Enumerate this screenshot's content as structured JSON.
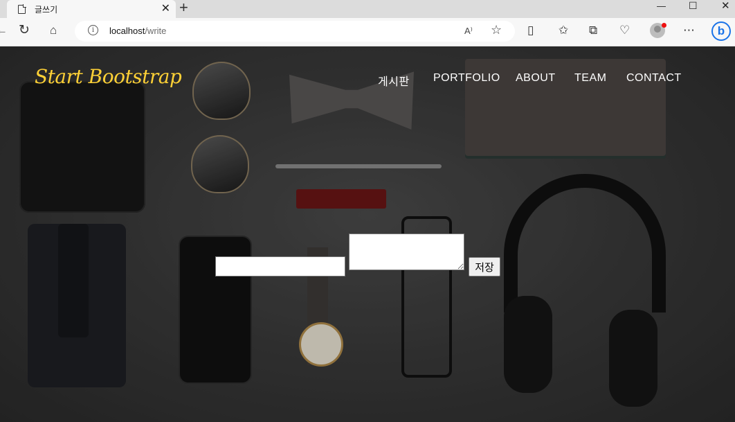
{
  "browser": {
    "tab_title": "글쓰기",
    "tab_close": "✕",
    "new_tab": "+",
    "window": {
      "minimize": "—",
      "maximize": "☐",
      "close": "✕"
    },
    "address": {
      "host": "localhost",
      "path": "/write"
    },
    "read_aloud": "A⁾",
    "icons": [
      "back-icon",
      "refresh-icon",
      "home-icon",
      "info-icon",
      "read-aloud-icon",
      "favorite-star-icon",
      "split-screen-icon",
      "favorites-icon",
      "collections-icon",
      "browser-essentials-icon",
      "profile-avatar-icon",
      "more-menu-icon",
      "bing-chat-icon"
    ]
  },
  "site": {
    "brand": "Start Bootstrap",
    "brand_color": "#fed136",
    "nav": [
      "게시판",
      "PORTFOLIO",
      "ABOUT",
      "TEAM",
      "CONTACT"
    ]
  },
  "form": {
    "title_value": "",
    "content_value": "",
    "save_label": "저장"
  }
}
